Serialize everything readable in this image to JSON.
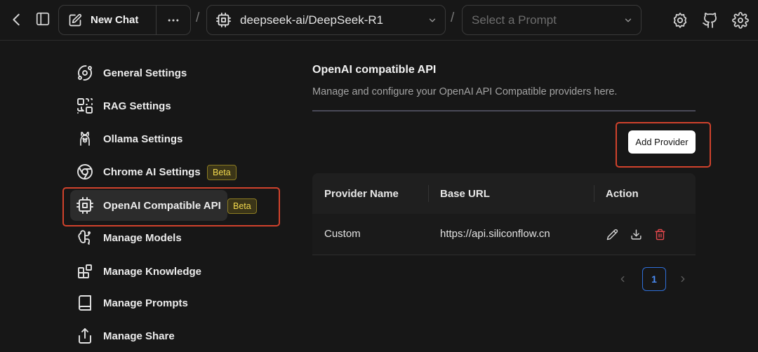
{
  "header": {
    "new_chat_label": "New Chat",
    "model_name": "deepseek-ai/DeepSeek-R1",
    "prompt_placeholder": "Select a Prompt",
    "separator": "/"
  },
  "sidebar": {
    "items": [
      {
        "label": "General Settings",
        "icon": "orbit-icon"
      },
      {
        "label": "RAG Settings",
        "icon": "combine-icon"
      },
      {
        "label": "Ollama Settings",
        "icon": "llama-icon"
      },
      {
        "label": "Chrome AI Settings",
        "icon": "chrome-icon",
        "badge": "Beta"
      },
      {
        "label": "OpenAI Compatible API",
        "icon": "cpu-icon",
        "badge": "Beta",
        "active": true
      },
      {
        "label": "Manage Models",
        "icon": "brain-icon"
      },
      {
        "label": "Manage Knowledge",
        "icon": "blocks-icon"
      },
      {
        "label": "Manage Prompts",
        "icon": "book-icon"
      },
      {
        "label": "Manage Share",
        "icon": "share-icon"
      }
    ]
  },
  "main": {
    "title": "OpenAI compatible API",
    "description": "Manage and configure your OpenAI API Compatible providers here.",
    "add_provider_label": "Add Provider",
    "table": {
      "columns": [
        "Provider Name",
        "Base URL",
        "Action"
      ],
      "rows": [
        {
          "name": "Custom",
          "base_url": "https://api.siliconflow.cn"
        }
      ]
    },
    "pagination": {
      "current_page": "1"
    }
  },
  "colors": {
    "background": "#171717",
    "highlight": "#d0422c",
    "beta_text": "#f2d94e",
    "page_accent": "#2f6fd8",
    "delete_icon": "#e5484d"
  }
}
